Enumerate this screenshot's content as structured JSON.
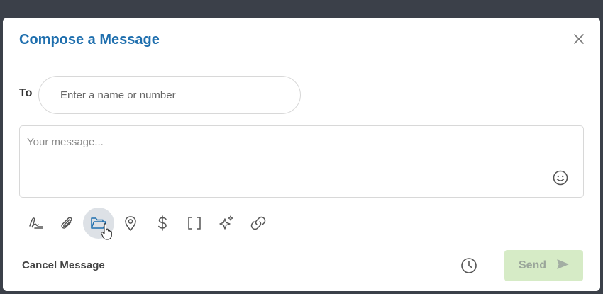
{
  "modal": {
    "title": "Compose a Message",
    "close_icon": "close-icon"
  },
  "recipient": {
    "label": "To",
    "placeholder": "Enter a name or number",
    "value": ""
  },
  "message": {
    "placeholder": "Your message...",
    "value": "",
    "emoji_icon": "smiley-icon"
  },
  "toolbar": {
    "tools": [
      {
        "icon": "signature-icon",
        "active": false
      },
      {
        "icon": "paperclip-icon",
        "active": false
      },
      {
        "icon": "folder-open-icon",
        "active": true
      },
      {
        "icon": "map-pin-icon",
        "active": false
      },
      {
        "icon": "dollar-icon",
        "active": false
      },
      {
        "icon": "brackets-icon",
        "active": false
      },
      {
        "icon": "sparkles-icon",
        "active": false
      },
      {
        "icon": "link-icon",
        "active": false
      }
    ]
  },
  "footer": {
    "cancel_label": "Cancel Message",
    "schedule_icon": "clock-icon",
    "send_label": "Send",
    "send_icon": "paper-plane-icon"
  },
  "colors": {
    "title": "#1f6fae",
    "send_bg": "#d6ebc6",
    "active_tool_bg": "#dde1e6",
    "backdrop": "#3b4049"
  }
}
